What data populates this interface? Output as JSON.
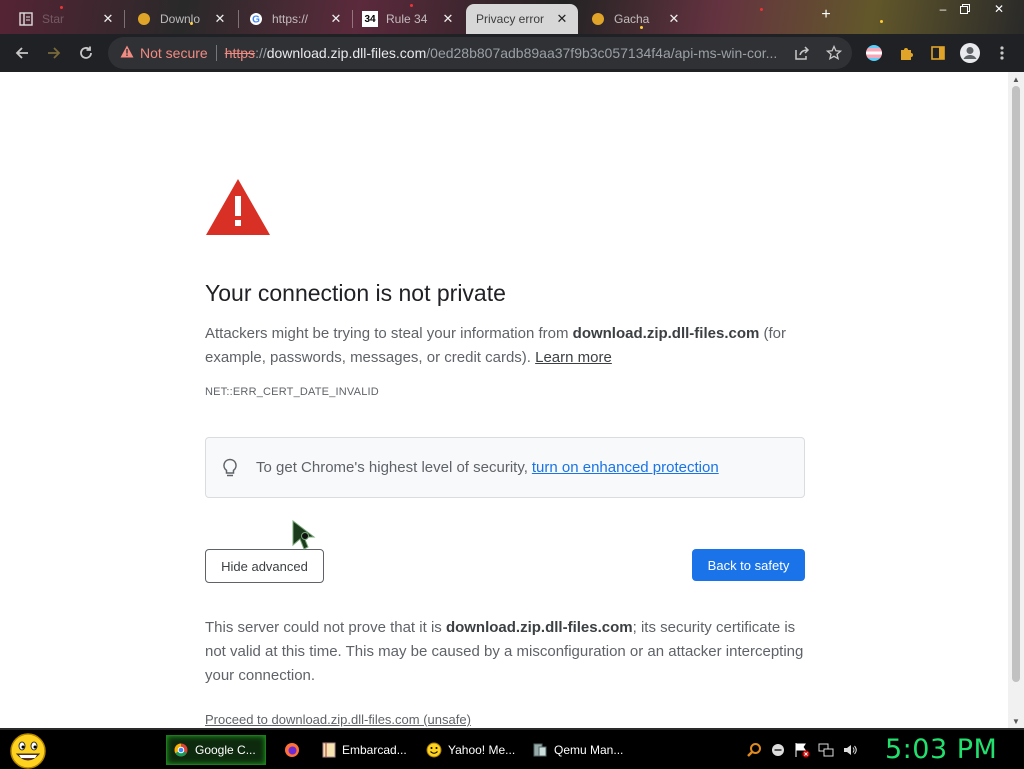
{
  "tabs": [
    {
      "title": "Star",
      "favicon": "sidebar-icon",
      "active": false
    },
    {
      "title": "Downlo",
      "favicon": "downloads-icon",
      "active": false
    },
    {
      "title": "https://",
      "favicon": "google-icon",
      "active": false
    },
    {
      "title": "Rule 34",
      "favicon": "rule34-icon",
      "active": false
    },
    {
      "title": "Privacy error",
      "favicon": "",
      "active": true
    },
    {
      "title": "Gacha",
      "favicon": "gacha-icon",
      "active": false
    }
  ],
  "omnibox": {
    "security_label": "Not secure",
    "scheme": "https",
    "scheme_sep": "://",
    "host": "download.zip.dll-files.com",
    "path": "/0ed28b807adb89aa37f9b3c057134f4a/api-ms-win-cor..."
  },
  "page": {
    "heading": "Your connection is not private",
    "explain_pre": "Attackers might be trying to steal your information from ",
    "explain_host": "download.zip.dll-files.com",
    "explain_post": " (for example, passwords, messages, or credit cards). ",
    "learn_more": "Learn more",
    "error_code": "NET::ERR_CERT_DATE_INVALID",
    "enhanced_text": "To get Chrome's highest level of security,",
    "enhanced_link": "turn on enhanced protection",
    "hide_advanced": "Hide advanced",
    "back_to_safety": "Back to safety",
    "details_pre": "This server could not prove that it is ",
    "details_host": "download.zip.dll-files.com",
    "details_post": "; its security certificate is not valid at this time. This may be caused by a misconfiguration or an attacker intercepting your connection.",
    "proceed": "Proceed to download.zip.dll-files.com (unsafe)"
  },
  "taskbar": {
    "items": [
      {
        "label": "Google C...",
        "icon": "chrome-icon",
        "active": true
      },
      {
        "label": "",
        "icon": "firefox-icon",
        "active": false
      },
      {
        "label": "Embarcad...",
        "icon": "embarcadero-icon",
        "active": false
      },
      {
        "label": "Yahoo! Me...",
        "icon": "yahoo-messenger-icon",
        "active": false
      },
      {
        "label": "Qemu Man...",
        "icon": "qemu-icon",
        "active": false
      }
    ],
    "clock": "5:03 PM"
  },
  "colors": {
    "primary_blue": "#1a73e8",
    "warning_red": "#d93025",
    "not_secure_red": "#f28b82",
    "clock_green": "#22e06e"
  }
}
